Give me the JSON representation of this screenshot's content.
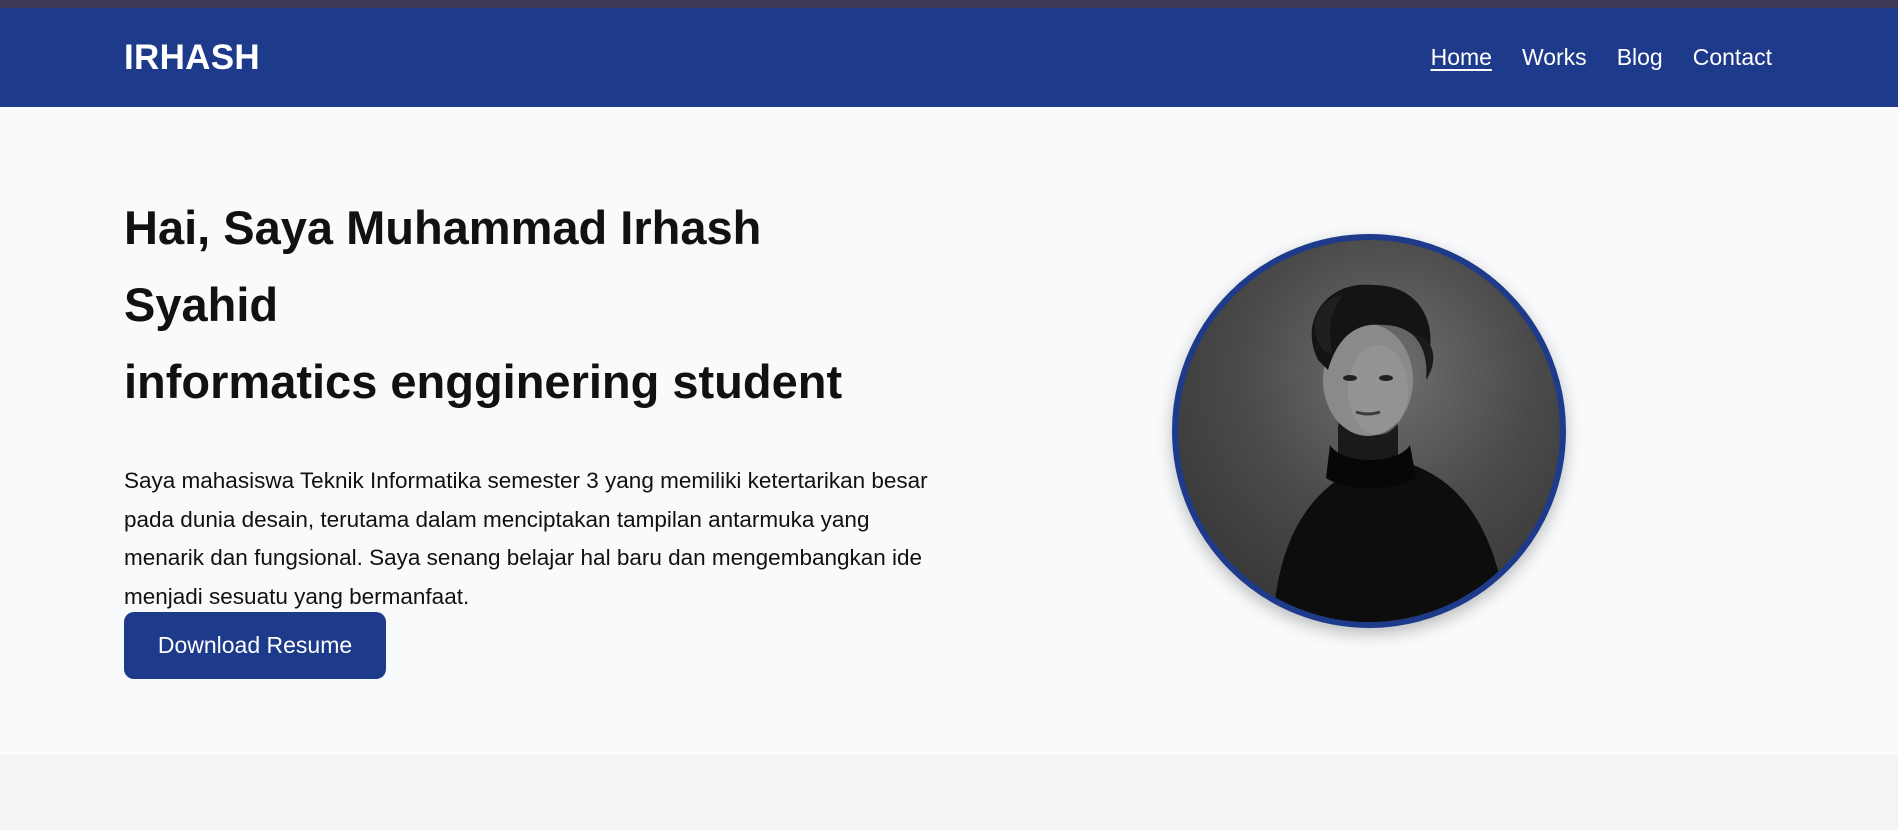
{
  "brand": "IRHASH",
  "nav": {
    "items": [
      {
        "label": "Home",
        "active": true
      },
      {
        "label": "Works",
        "active": false
      },
      {
        "label": "Blog",
        "active": false
      },
      {
        "label": "Contact",
        "active": false
      }
    ]
  },
  "hero": {
    "title_line1": "Hai, Saya Muhammad Irhash",
    "title_line2": "Syahid",
    "title_line3": "informatics engginering student",
    "description": "Saya mahasiswa Teknik Informatika semester 3 yang memiliki ketertarikan besar pada dunia desain, terutama dalam menciptakan tampilan antarmuka yang menarik dan fungsional. Saya senang belajar hal baru dan mengembangkan ide menjadi sesuatu yang bermanfaat.",
    "cta_label": "Download Resume"
  },
  "colors": {
    "primary": "#1e3a8a",
    "top_strip": "#3f3a57",
    "hero_bg": "#f8fafc",
    "page_bg": "#f3f4f6"
  },
  "icons": {
    "profile": "profile-photo"
  }
}
